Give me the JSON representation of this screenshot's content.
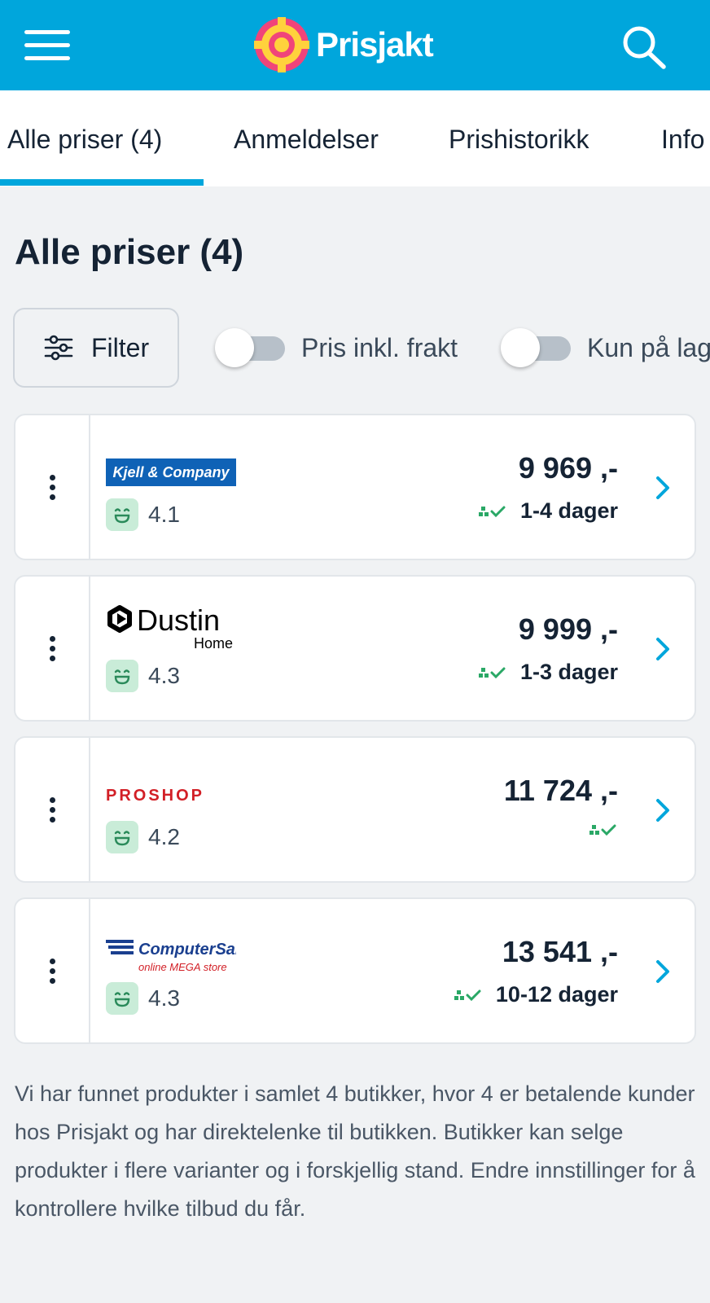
{
  "header": {
    "brand": "Prisjakt",
    "menu_icon": "hamburger-menu-icon",
    "search_icon": "search-icon",
    "bar_color": "#00a6dc"
  },
  "tabs": [
    {
      "label": "Alle priser (4)",
      "active": true
    },
    {
      "label": "Anmeldelser",
      "active": false
    },
    {
      "label": "Prishistorikk",
      "active": false
    },
    {
      "label": "Info",
      "active": false
    }
  ],
  "page_title": "Alle priser (4)",
  "filters": {
    "filter_label": "Filter",
    "filter_icon": "sliders-icon",
    "toggles": [
      {
        "label": "Pris inkl. frakt",
        "checked": false
      },
      {
        "label": "Kun på lag",
        "checked": false
      }
    ]
  },
  "offers": [
    {
      "store": "Kjell & Company",
      "rating": "4.1",
      "price": "9 969 ,-",
      "delivery": "1-4 dager",
      "in_stock": true
    },
    {
      "store": "Dustin",
      "store_sub": "Home",
      "rating": "4.3",
      "price": "9 999 ,-",
      "delivery": "1-3 dager",
      "in_stock": true
    },
    {
      "store": "PROSHOP",
      "rating": "4.2",
      "price": "11 724 ,-",
      "delivery": "",
      "in_stock": true
    },
    {
      "store": "ComputerSalg",
      "store_sub": "online MEGA store",
      "rating": "4.3",
      "price": "13 541 ,-",
      "delivery": "10-12 dager",
      "in_stock": true
    }
  ],
  "footer_text": "Vi har funnet produkter i samlet 4 butikker, hvor 4 er betalende kunder hos Prisjakt og har direktelenke til butikken. Butikker kan selge produkter i flere varianter og i forskjellig stand. Endre innstillinger for å kontrollere hvilke tilbud du får.",
  "colors": {
    "accent": "#00a6dc",
    "rating_bg": "#c9ecd8",
    "stock_green": "#2aa866",
    "page_bg": "#f0f2f4"
  }
}
